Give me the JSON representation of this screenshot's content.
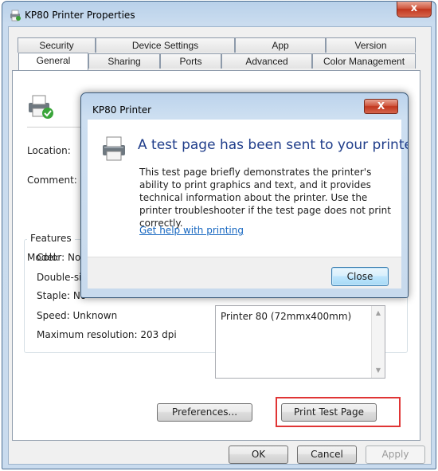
{
  "window": {
    "title": "KP80 Printer Properties",
    "close_glyph": "x"
  },
  "tabs": {
    "row1": [
      "Security",
      "Device Settings",
      "App",
      "Version"
    ],
    "row2": [
      "General",
      "Sharing",
      "Ports",
      "Advanced",
      "Color Management"
    ]
  },
  "general": {
    "location_label": "Location:",
    "comment_label": "Comment:",
    "model_label": "Model:",
    "features_title": "Features",
    "features": {
      "color": "Color: No",
      "double_sided": "Double-sided: No",
      "staple": "Staple: No",
      "speed": "Speed: Unknown",
      "max_resolution": "Maximum resolution: 203 dpi"
    },
    "paper_item": "Printer 80 (72mmx400mm)",
    "preferences_label": "Preferences...",
    "print_test_page_label": "Print Test Page"
  },
  "footer": {
    "ok": "OK",
    "cancel": "Cancel",
    "apply": "Apply"
  },
  "dialog": {
    "title": "KP80 Printer",
    "heading": "A test page has been sent to your printer",
    "body": "This test page briefly demonstrates the printer's ability to print graphics and text, and it provides technical information about the printer. Use the printer troubleshooter if the test page does not print correctly.",
    "link": "Get help with printing",
    "close_label": "Close",
    "close_glyph": "X"
  },
  "colors": {
    "title_bar": "#c9dbee",
    "highlight_border": "#e03535",
    "heading_blue": "#1f3d8a",
    "link_blue": "#1566c0"
  }
}
